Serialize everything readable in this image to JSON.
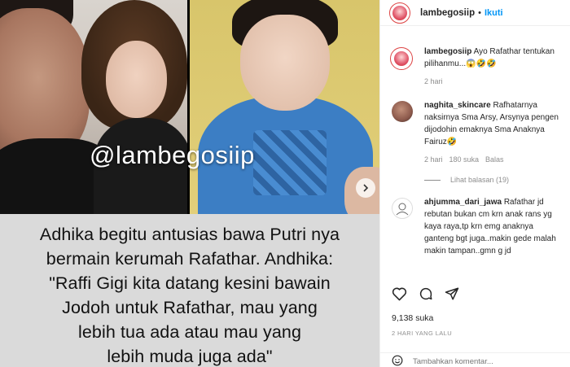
{
  "post": {
    "watermark": "@lambegosiip",
    "caption_image_text": "Adhika begitu antusias bawa Putri nya\nbermain kerumah Rafathar. Andhika:\n\"Raffi Gigi kita datang kesini bawain\nJodoh untuk Rafathar, mau yang\nlebih tua ada atau mau yang\nlebih muda juga ada\""
  },
  "header": {
    "username": "lambegosiip",
    "separator": "•",
    "follow_label": "Ikuti"
  },
  "comments": [
    {
      "username": "lambegosiip",
      "text": "Ayo Rafathar tentukan pilihanmu...😱🤣🤣",
      "time": "2 hari"
    },
    {
      "username": "naghita_skincare",
      "text": "Rafhatarnya naksirnya Sma Arsy, Arsynya pengen dijodohin emaknya Sma Anaknya Fairuz🤣",
      "time": "2 hari",
      "likes": "180 suka",
      "reply": "Balas",
      "view_replies": "Lihat balasan (19)"
    },
    {
      "username": "ahjumma_dari_jawa",
      "text": "Rafathar jd rebutan bukan cm krn anak rans yg kaya raya,tp krn emg anaknya ganteng bgt juga..makin gede malah makin tampan..gmn g jd"
    }
  ],
  "stats": {
    "likes": "9,138 suka",
    "date": "2 HARI YANG LALU"
  },
  "comment_input": {
    "placeholder": "Tambahkan komentar..."
  },
  "colors": {
    "accent": "#0095f6",
    "caption_bg": "#dadada",
    "muted": "#8e8e8e"
  }
}
